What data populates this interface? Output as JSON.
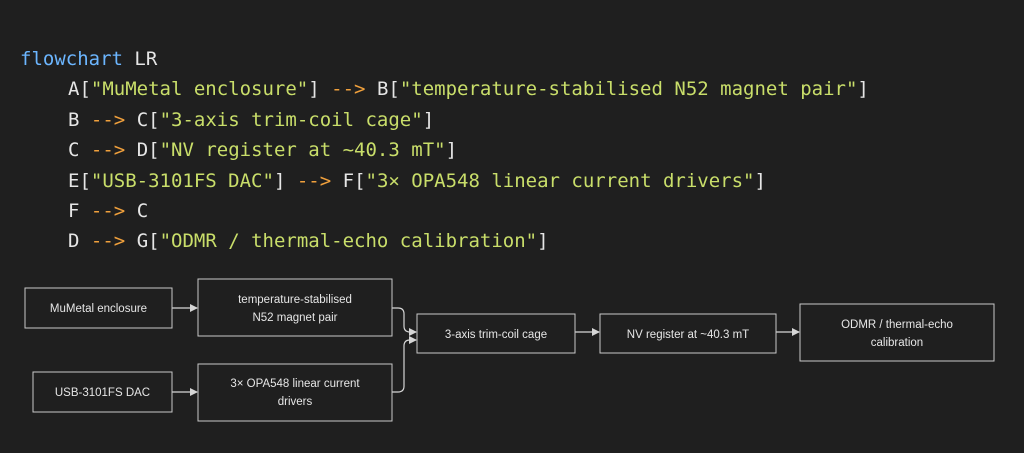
{
  "code": {
    "keyword": "flowchart",
    "direction": "LR",
    "arrow": "-->",
    "lines": [
      {
        "a": "A",
        "a_label": "\"MuMetal enclosure\"",
        "b": "B",
        "b_label": "\"temperature-stabilised N52 magnet pair\""
      },
      {
        "a": "B",
        "a_label": "",
        "b": "C",
        "b_label": "\"3-axis trim-coil cage\""
      },
      {
        "a": "C",
        "a_label": "",
        "b": "D",
        "b_label": "\"NV register at ~40.3 mT\""
      },
      {
        "a": "E",
        "a_label": "\"USB-3101FS DAC\"",
        "b": "F",
        "b_label": "\"3× OPA548 linear current drivers\""
      },
      {
        "a": "F",
        "a_label": "",
        "b": "C",
        "b_label": ""
      },
      {
        "a": "D",
        "a_label": "",
        "b": "G",
        "b_label": "\"ODMR / thermal-echo calibration\""
      }
    ]
  },
  "diagram": {
    "nodes": {
      "A": {
        "lines": [
          "MuMetal enclosure"
        ]
      },
      "B": {
        "lines": [
          "temperature-stabilised",
          "N52 magnet pair"
        ]
      },
      "C": {
        "lines": [
          "3-axis trim-coil cage"
        ]
      },
      "D": {
        "lines": [
          "NV register at ~40.3 mT"
        ]
      },
      "E": {
        "lines": [
          "USB-3101FS DAC"
        ]
      },
      "F": {
        "lines": [
          "3× OPA548 linear current",
          "drivers"
        ]
      },
      "G": {
        "lines": [
          "ODMR / thermal-echo",
          "calibration"
        ]
      }
    },
    "edges": [
      [
        "A",
        "B"
      ],
      [
        "B",
        "C"
      ],
      [
        "C",
        "D"
      ],
      [
        "E",
        "F"
      ],
      [
        "F",
        "C"
      ],
      [
        "D",
        "G"
      ]
    ]
  }
}
